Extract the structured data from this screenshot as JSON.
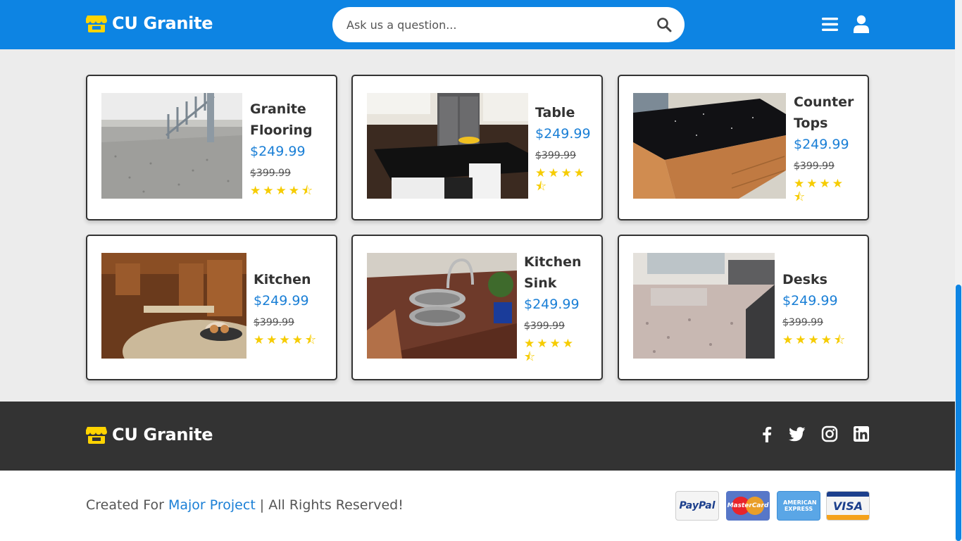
{
  "header": {
    "brand": "CU Granite",
    "search_placeholder": "Ask us a question..."
  },
  "products": [
    {
      "name": "Granite Flooring",
      "price": "$249.99",
      "old_price": "$399.99",
      "rating": 4.5
    },
    {
      "name": "Table",
      "price": "$249.99",
      "old_price": "$399.99",
      "rating": 4.5
    },
    {
      "name": "Counter Tops",
      "price": "$249.99",
      "old_price": "$399.99",
      "rating": 4.5
    },
    {
      "name": "Kitchen",
      "price": "$249.99",
      "old_price": "$399.99",
      "rating": 4.5
    },
    {
      "name": "Kitchen Sink",
      "price": "$249.99",
      "old_price": "$399.99",
      "rating": 4.5
    },
    {
      "name": "Desks",
      "price": "$249.99",
      "old_price": "$399.99",
      "rating": 4.5
    }
  ],
  "footer": {
    "brand": "CU Granite",
    "social": [
      "facebook-icon",
      "twitter-icon",
      "instagram-icon",
      "linkedin-icon"
    ],
    "copyright_prefix": "Created For ",
    "copyright_link": "Major Project",
    "copyright_suffix": " | All Rights Reserved!",
    "payments": [
      {
        "name": "PayPal"
      },
      {
        "name": "MasterCard"
      },
      {
        "name": "AMERICAN EXPRESS"
      },
      {
        "name": "VISA"
      }
    ]
  },
  "colors": {
    "brand_blue": "#0d84e3",
    "price_blue": "#1a7fd6",
    "star_yellow": "#f6cc00",
    "footer_dark": "#333333",
    "logo_yellow": "#ffd400"
  }
}
